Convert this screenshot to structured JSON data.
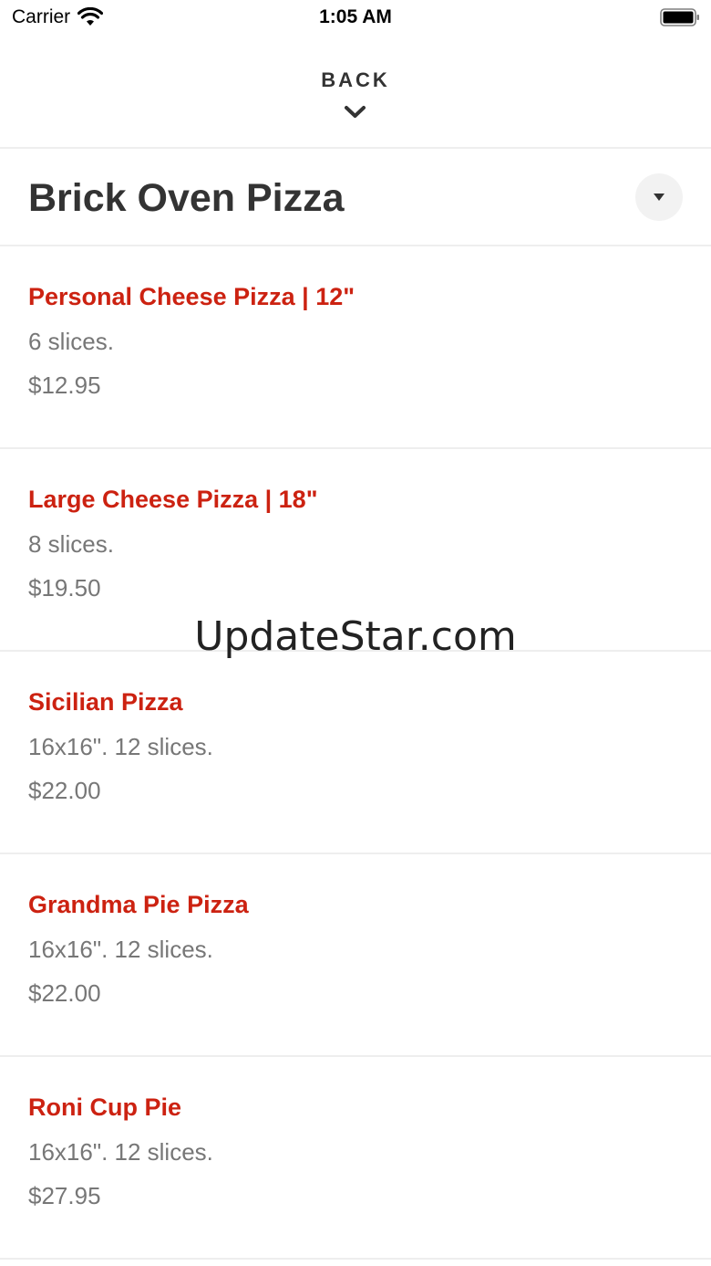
{
  "status_bar": {
    "carrier": "Carrier",
    "time": "1:05 AM",
    "wifi_icon": "wifi-icon",
    "battery_icon": "battery-icon"
  },
  "header": {
    "back_label": "BACK",
    "back_icon": "chevron-down-icon"
  },
  "category": {
    "title": "Brick Oven Pizza",
    "dropdown_icon": "caret-down-icon"
  },
  "menu_items": [
    {
      "name": "Personal Cheese Pizza | 12\"",
      "description": "6 slices.",
      "price": "$12.95"
    },
    {
      "name": "Large Cheese Pizza | 18\"",
      "description": "8 slices.",
      "price": "$19.50"
    },
    {
      "name": "Sicilian Pizza",
      "description": "16x16\". 12 slices.",
      "price": "$22.00"
    },
    {
      "name": "Grandma Pie Pizza",
      "description": "16x16\". 12 slices.",
      "price": "$22.00"
    },
    {
      "name": "Roni Cup Pie",
      "description": "16x16\". 12 slices.",
      "price": "$27.95"
    }
  ],
  "watermark": "UpdateStar.com",
  "colors": {
    "accent": "#cc2211",
    "text_primary": "#333333",
    "text_secondary": "#777777",
    "divider": "#eeeeee"
  }
}
